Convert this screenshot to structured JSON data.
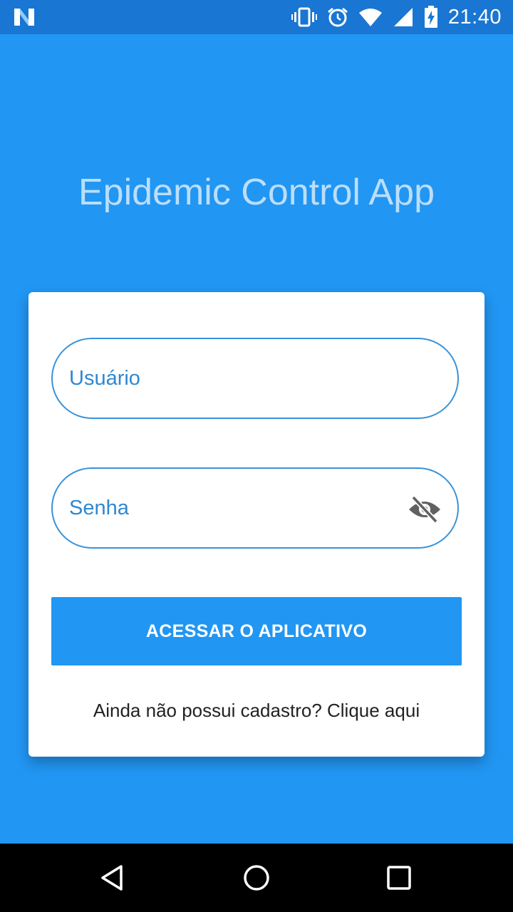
{
  "status_bar": {
    "time": "21:40",
    "icons": [
      "notification-n-icon",
      "vibrate-icon",
      "alarm-icon",
      "wifi-icon",
      "signal-icon",
      "battery-charging-icon"
    ]
  },
  "app": {
    "title": "Epidemic Control App"
  },
  "login_form": {
    "username_label": "Usuário",
    "password_label": "Senha",
    "password_visibility_icon": "visibility-off-icon",
    "submit_label": "ACESSAR O APLICATIVO",
    "signup_prompt": "Ainda não possui cadastro? Clique aqui"
  },
  "nav_bar": {
    "icons": [
      "back-icon",
      "home-icon",
      "recents-icon"
    ]
  },
  "colors": {
    "background": "#2196F3",
    "status_bar": "#1976D2",
    "title": "#BBDEFB",
    "field_border": "#3A93D8",
    "button": "#2196F3"
  }
}
